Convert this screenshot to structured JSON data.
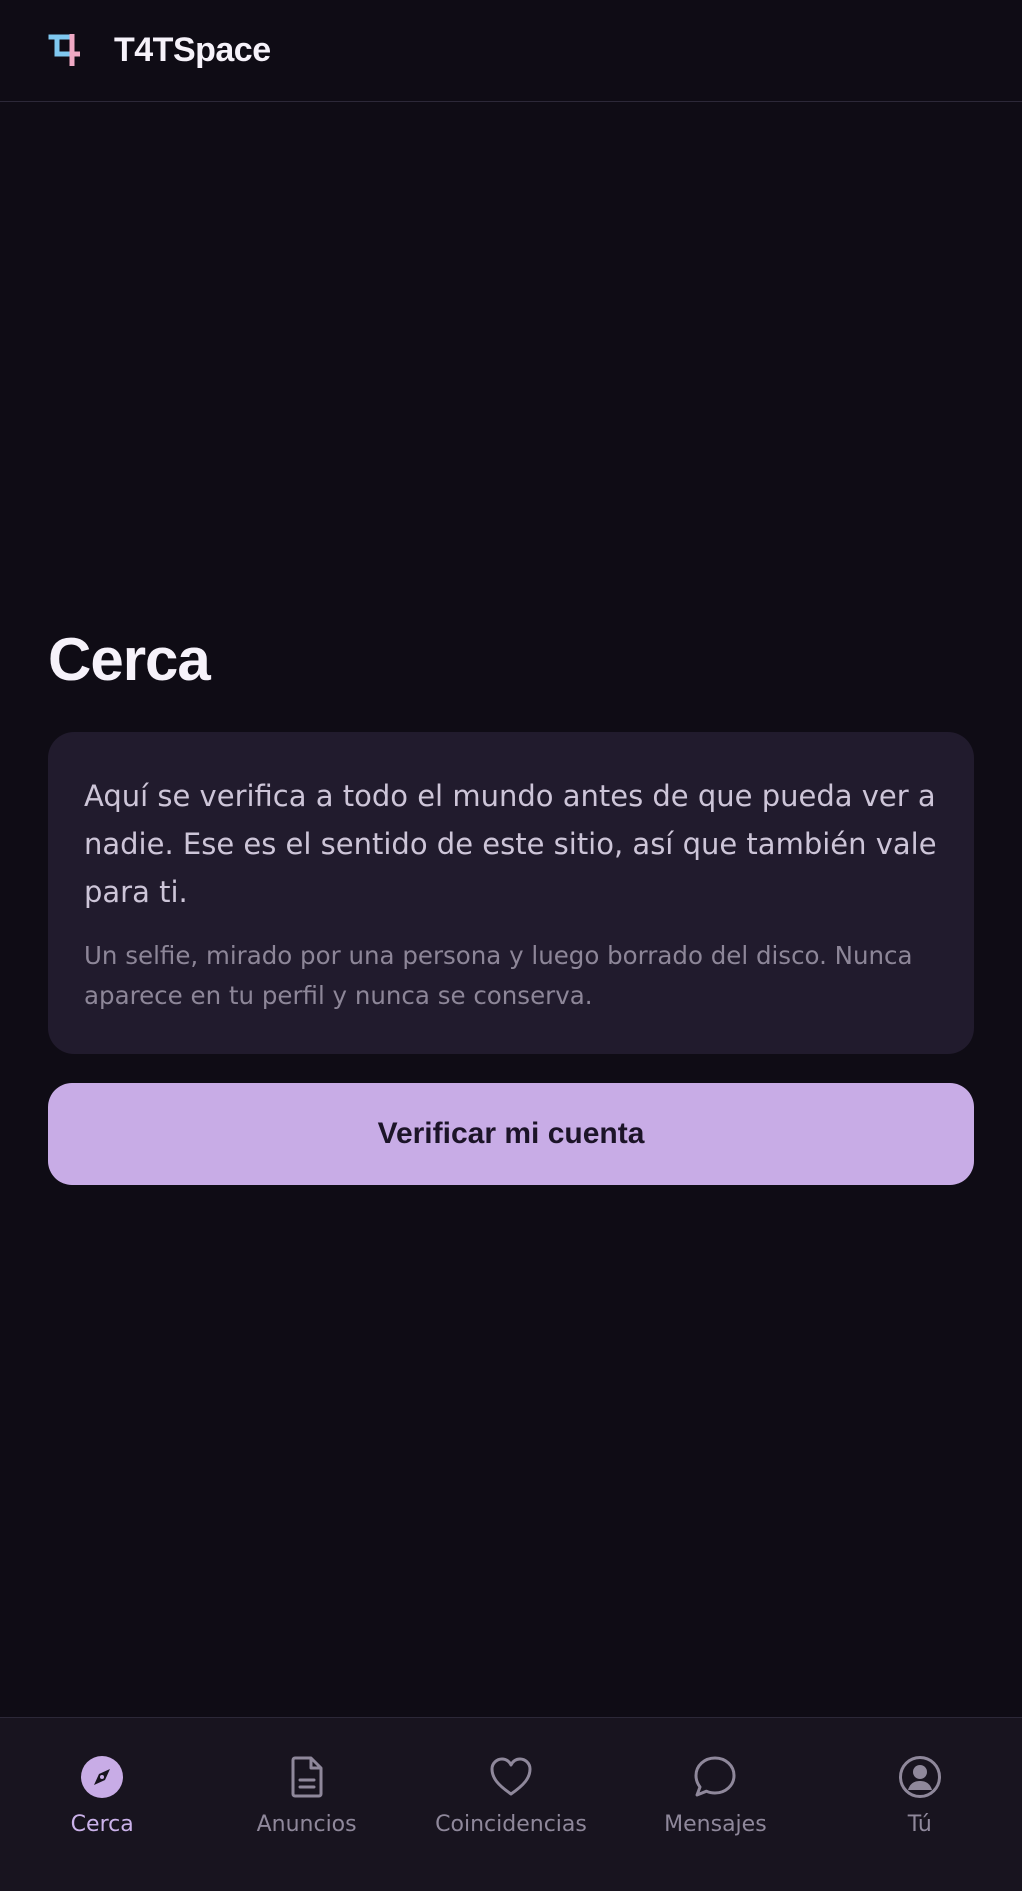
{
  "header": {
    "brand": "T4TSpace",
    "logo_icon": "t4-logo-icon"
  },
  "main": {
    "title": "Cerca",
    "card": {
      "lead": "Aquí se verifica a todo el mundo antes de que pueda ver a nadie. Ese es el sentido de este sitio, así que también vale para ti.",
      "note": "Un selfie, mirado por una persona y luego borrado del disco. Nunca aparece en tu perfil y nunca se conserva."
    },
    "verify_button_label": "Verificar mi cuenta"
  },
  "nav": {
    "active": "Cerca",
    "items": [
      {
        "label": "Cerca",
        "icon": "compass-icon"
      },
      {
        "label": "Anuncios",
        "icon": "document-icon"
      },
      {
        "label": "Coincidencias",
        "icon": "heart-icon"
      },
      {
        "label": "Mensajes",
        "icon": "chat-bubble-icon"
      },
      {
        "label": "Tú",
        "icon": "user-circle-icon"
      }
    ]
  },
  "colors": {
    "background": "#0f0c15",
    "card": "#211b2d",
    "accent": "#c8ace6",
    "nav_background": "#18141f",
    "logo_blue": "#7fc8f0",
    "logo_pink": "#f0a9c4"
  }
}
